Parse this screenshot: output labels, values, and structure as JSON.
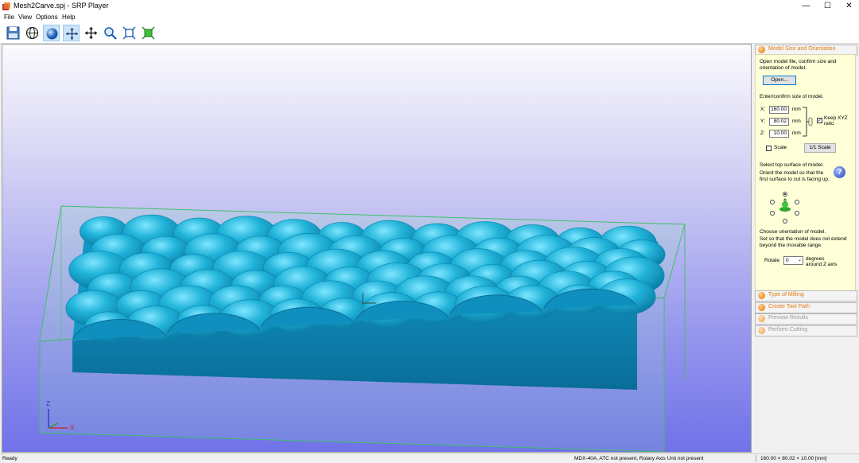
{
  "window": {
    "title": "Mesh2Carve.spj - SRP Player",
    "minimize": "—",
    "maximize": "☐",
    "close": "✕"
  },
  "menu": [
    "File",
    "View",
    "Options",
    "Help"
  ],
  "toolbar": [
    "save-icon",
    "globe-icon",
    "sphere-icon",
    "pan-icon",
    "move-icon",
    "zoom-icon",
    "fit-icon",
    "fit-selection-icon"
  ],
  "panel": {
    "model_size": {
      "header": "Model Size and Orientation",
      "open_text": "Open model file, confirm size and orientation of model.",
      "open_button": "Open...",
      "size_text": "Enter/confirm size of model.",
      "x_label": "X:",
      "x_value": "160.00",
      "x_unit": "mm",
      "y_label": "Y:",
      "y_value": "80.02",
      "y_unit": "mm",
      "z_label": "Z:",
      "z_value": "10.00",
      "z_unit": "mm",
      "keep_ratio": "Keep XYZ ratio",
      "keep_ratio_checked": "✓",
      "scale_label": "Scale",
      "scale_button": "1/1 Scale",
      "top_surface_text": "Select top surface of model.",
      "orient_text": "Orient the model so that the first surface to cut is facing up.",
      "help_glyph": "?",
      "choose_text": "Choose orientation of model.",
      "range_text": "Set so that the model does not extend beyond the movable range.",
      "rotate_label": "Rotate",
      "rotate_value": "0",
      "degrees_text": "degrees around Z axis"
    },
    "sections": [
      "Type of Milling",
      "Create Tool Path",
      "Preview Results",
      "Perform Cutting"
    ]
  },
  "axes": {
    "z": "Z",
    "x": "X"
  },
  "status": {
    "left": "Ready",
    "machine": "MDX-40A, ATC not present, Rotary Axis Unit not present",
    "size": "160.00 × 80.02 × 10.00 [mm]"
  },
  "colors": {
    "accent": "#e07b12",
    "panel_bg": "#ffffd8",
    "model": "#1ea6cc",
    "box_edge": "#3fbf6a"
  }
}
